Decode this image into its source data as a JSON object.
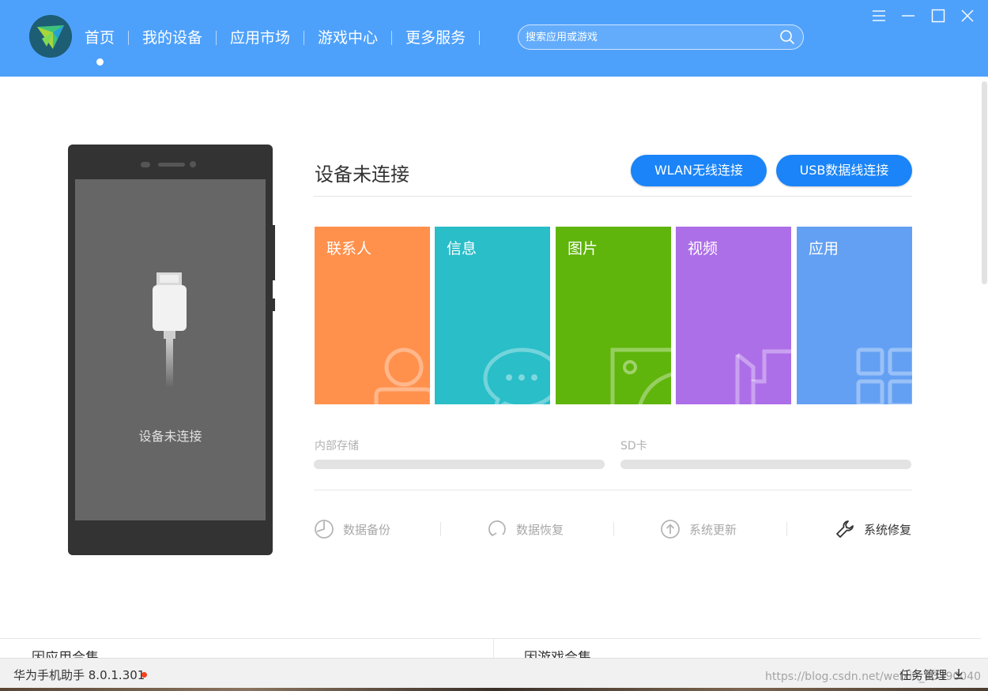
{
  "header": {
    "nav": [
      {
        "label": "首页",
        "active": true
      },
      {
        "label": "我的设备"
      },
      {
        "label": "应用市场"
      },
      {
        "label": "游戏中心"
      },
      {
        "label": "更多服务"
      }
    ],
    "search_placeholder": "搜索应用或游戏",
    "window_controls": [
      "menu-icon",
      "minimize-icon",
      "maximize-icon",
      "close-icon"
    ],
    "bg_color": "#4ea1fb"
  },
  "phone": {
    "status_text": "设备未连接",
    "icon": "usb-cable-icon"
  },
  "main": {
    "title": "设备未连接",
    "wlan_button": "WLAN无线连接",
    "usb_button": "USB数据线连接",
    "tiles": [
      {
        "label": "联系人",
        "color": "#ff914d",
        "icon": "contacts-icon"
      },
      {
        "label": "信息",
        "color": "#29bec8",
        "icon": "message-icon"
      },
      {
        "label": "图片",
        "color": "#5fb50b",
        "icon": "picture-icon"
      },
      {
        "label": "视频",
        "color": "#ad6fe8",
        "icon": "video-icon"
      },
      {
        "label": "应用",
        "color": "#63a0f3",
        "icon": "apps-icon"
      }
    ],
    "storage": [
      {
        "label": "内部存储"
      },
      {
        "label": "SD卡"
      }
    ],
    "actions": [
      {
        "label": "数据备份",
        "icon": "backup-icon",
        "enabled": false
      },
      {
        "label": "数据恢复",
        "icon": "restore-icon",
        "enabled": false
      },
      {
        "label": "系统更新",
        "icon": "update-icon",
        "enabled": false
      },
      {
        "label": "系统修复",
        "icon": "wrench-icon",
        "enabled": true
      }
    ]
  },
  "bottom": {
    "left_peek": "因应用合集",
    "right_peek": "因游戏合集"
  },
  "statusbar": {
    "app_version": "华为手机助手 8.0.1.301",
    "task_manager": "任务管理",
    "watermark": "https://blog.csdn.net/weixin_43390040"
  }
}
